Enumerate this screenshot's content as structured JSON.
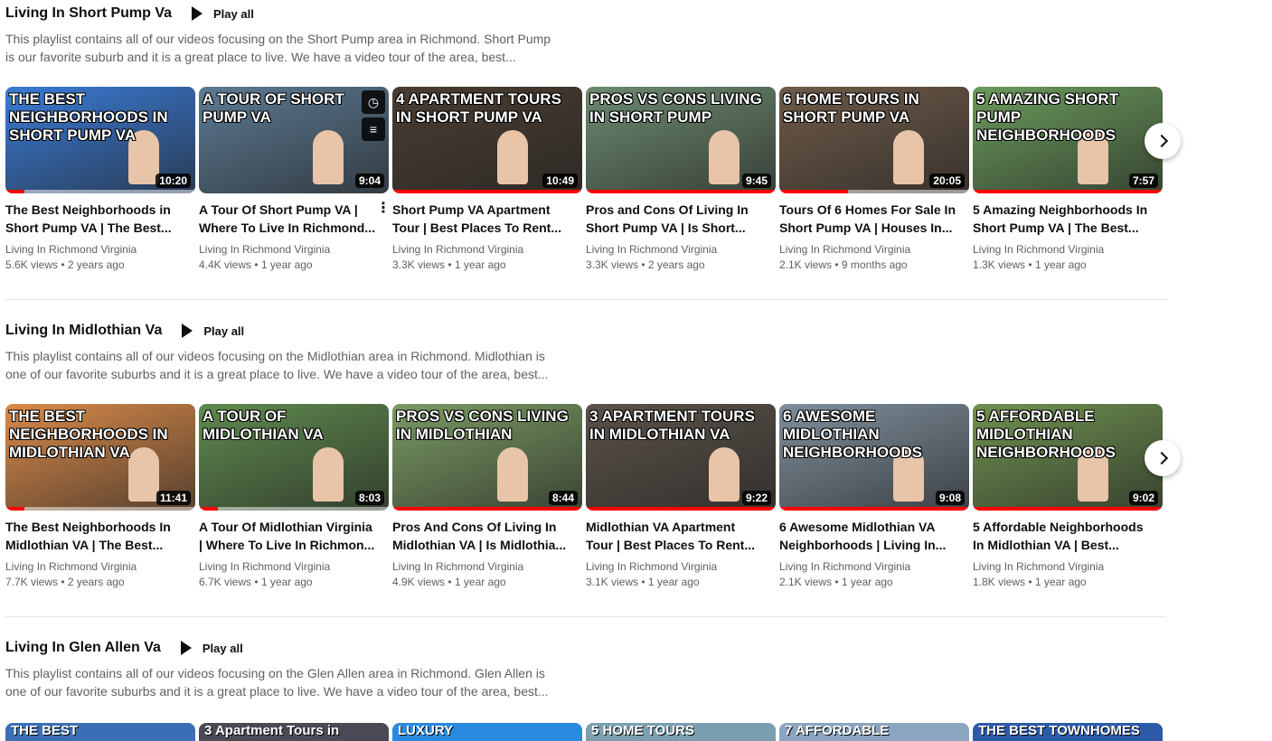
{
  "sections": [
    {
      "title": "Living In Short Pump Va",
      "play_all": "Play all",
      "desc_line1": "This playlist contains all of our videos focusing on the Short Pump area in Richmond. Short Pump",
      "desc_line2": "is our favorite suburb and it is a great place to live. We have a video tour of the area, best...",
      "videos": [
        {
          "thumb_text": "The Best Neighborhoods in Short Pump VA",
          "duration": "10:20",
          "title1": "The Best Neighborhoods in",
          "title2": "Short Pump VA | The Best...",
          "channel": "Living In Richmond Virginia",
          "meta": "5.6K views • 2 years ago",
          "color": "#3a7bd5",
          "progress": 0.1
        },
        {
          "thumb_text": "A Tour of Short Pump VA",
          "duration": "9:04",
          "title1": "A Tour Of Short Pump VA |",
          "title2": "Where To Live In Richmond...",
          "channel": "Living In Richmond Virginia",
          "meta": "4.4K views • 1 year ago",
          "color": "#5c7a93",
          "progress": 0
        },
        {
          "thumb_text": "4 Apartment Tours in Short Pump VA",
          "duration": "10:49",
          "title1": "Short Pump VA Apartment",
          "title2": "Tour | Best Places To Rent...",
          "channel": "Living In Richmond Virginia",
          "meta": "3.3K views • 1 year ago",
          "color": "#4a3d32",
          "progress": 1.0
        },
        {
          "thumb_text": "Pros vs Cons Living in Short Pump",
          "duration": "9:45",
          "title1": "Pros and Cons Of Living In",
          "title2": "Short Pump VA | Is Short...",
          "channel": "Living In Richmond Virginia",
          "meta": "3.3K views • 2 years ago",
          "color": "#6d8a70",
          "progress": 1.0
        },
        {
          "thumb_text": "6 Home Tours in Short Pump VA",
          "duration": "20:05",
          "title1": "Tours Of 6 Homes For Sale In",
          "title2": "Short Pump VA | Houses In...",
          "channel": "Living In Richmond Virginia",
          "meta": "2.1K views • 9 months ago",
          "color": "#6e5a48",
          "progress": 0.36
        },
        {
          "thumb_text": "5 Amazing Short Pump Neighborhoods",
          "duration": "7:57",
          "title1": "5 Amazing Neighborhoods In",
          "title2": "Short Pump VA | The Best...",
          "channel": "Living In Richmond Virginia",
          "meta": "1.3K views • 1 year ago",
          "color": "#6a9a5b",
          "progress": 1.0
        }
      ]
    },
    {
      "title": "Living In Midlothian Va",
      "play_all": "Play all",
      "desc_line1": "This playlist contains all of our videos focusing on the Midlothian area in Richmond. Midlothian is",
      "desc_line2": "one of our favorite suburbs and it is a great place to live. We have a video tour of the area, best...",
      "videos": [
        {
          "thumb_text": "The Best Neighborhoods in Midlothian VA",
          "duration": "11:41",
          "title1": "The Best Neighborhoods In",
          "title2": "Midlothian VA | The Best...",
          "channel": "Living In Richmond Virginia",
          "meta": "7.7K views • 2 years ago",
          "color": "#d98a4a",
          "progress": 0.1
        },
        {
          "thumb_text": "A Tour of Midlothian VA",
          "duration": "8:03",
          "title1": "A Tour Of Midlothian Virginia",
          "title2": "| Where To Live In Richmon...",
          "channel": "Living In Richmond Virginia",
          "meta": "6.7K views • 1 year ago",
          "color": "#5f8a4e",
          "progress": 0.1
        },
        {
          "thumb_text": "Pros vs Cons Living in Midlothian",
          "duration": "8:44",
          "title1": "Pros And Cons Of Living In",
          "title2": "Midlothian VA | Is Midlothia...",
          "channel": "Living In Richmond Virginia",
          "meta": "4.9K views • 1 year ago",
          "color": "#7a9a63",
          "progress": 1.0
        },
        {
          "thumb_text": "3 Apartment Tours in Midlothian VA",
          "duration": "9:22",
          "title1": "Midlothian VA Apartment",
          "title2": "Tour | Best Places To Rent...",
          "channel": "Living In Richmond Virginia",
          "meta": "3.1K views • 1 year ago",
          "color": "#5b5249",
          "progress": 1.0
        },
        {
          "thumb_text": "6 Awesome Midlothian Neighborhoods",
          "duration": "9:08",
          "title1": "6 Awesome Midlothian VA",
          "title2": "Neighborhoods | Living In...",
          "channel": "Living In Richmond Virginia",
          "meta": "2.1K views • 1 year ago",
          "color": "#7f8f9c",
          "progress": 1.0
        },
        {
          "thumb_text": "5 Affordable Midlothian Neighborhoods",
          "duration": "9:02",
          "title1": "5 Affordable Neighborhoods",
          "title2": "In Midlothian VA | Best...",
          "channel": "Living In Richmond Virginia",
          "meta": "1.8K views • 1 year ago",
          "color": "#6f9150",
          "progress": 1.0
        }
      ]
    },
    {
      "title": "Living In Glen Allen Va",
      "play_all": "Play all",
      "desc_line1": "This playlist contains all of our videos focusing on the Glen Allen area in Richmond. Glen Allen is",
      "desc_line2": "one of our favorite suburbs and it is a great place to live. We have a video tour of the area, best...",
      "partial_thumbs": [
        {
          "text": "THE BEST",
          "color": "#3a6fb5"
        },
        {
          "text": "3 Apartment Tours in",
          "color": "#4a4a55"
        },
        {
          "text": "LUXURY",
          "color": "#2a8ae0"
        },
        {
          "text": "5 HOME TOURS",
          "color": "#7aa0b0"
        },
        {
          "text": "7 AFFORDABLE",
          "color": "#8aa5c0"
        },
        {
          "text": "THE BEST TOWNHOMES",
          "color": "#2d5aa8"
        }
      ]
    }
  ]
}
